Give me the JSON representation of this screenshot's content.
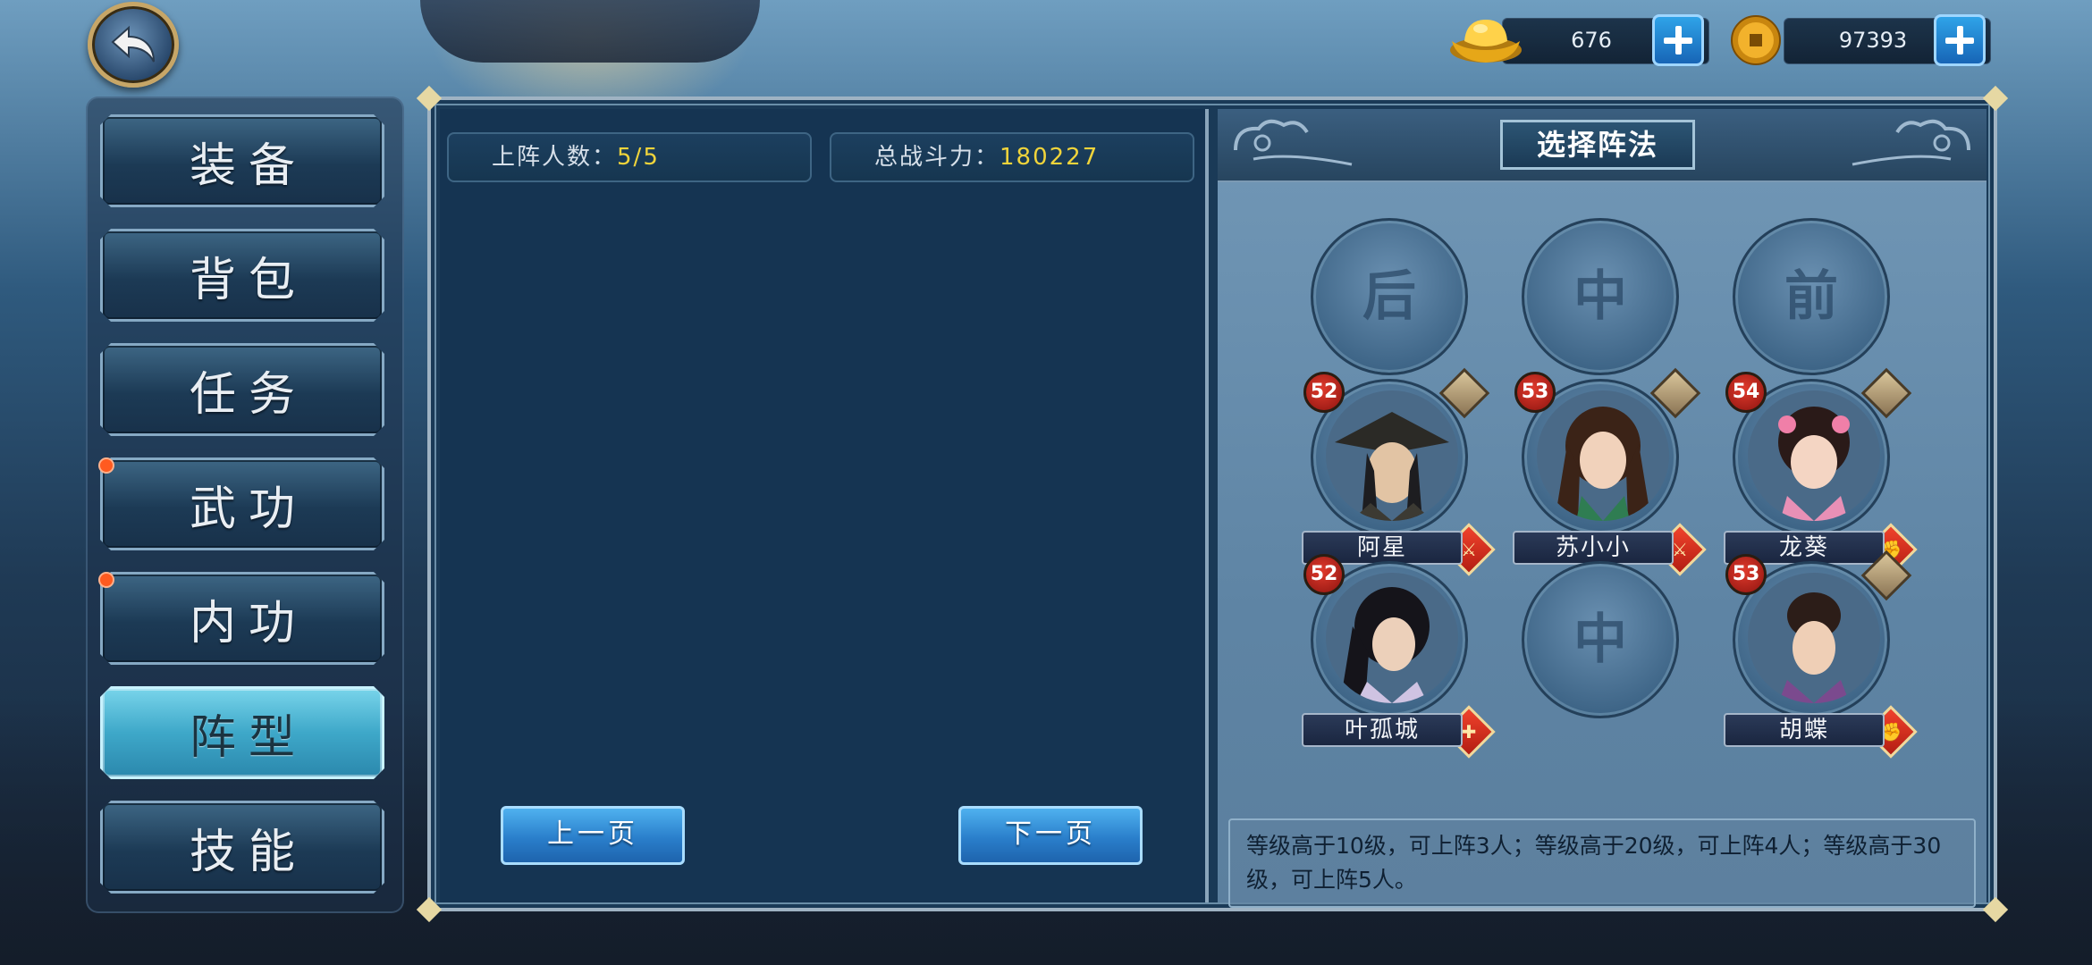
{
  "currency": {
    "gold": {
      "value": "676",
      "icon": "gold-ingot-icon"
    },
    "coin": {
      "value": "97393",
      "icon": "copper-coin-icon"
    }
  },
  "menu": {
    "items": [
      {
        "label": "装备",
        "active": false,
        "dot": false
      },
      {
        "label": "背包",
        "active": false,
        "dot": false
      },
      {
        "label": "任务",
        "active": false,
        "dot": false
      },
      {
        "label": "武功",
        "active": false,
        "dot": true
      },
      {
        "label": "内功",
        "active": false,
        "dot": true
      },
      {
        "label": "阵型",
        "active": true,
        "dot": false
      },
      {
        "label": "技能",
        "active": false,
        "dot": false
      }
    ]
  },
  "stats": {
    "members_label": "上阵人数：",
    "members_value": "5/5",
    "power_label": "总战斗力：",
    "power_value": "180227"
  },
  "pager": {
    "prev": "上一页",
    "next": "下一页"
  },
  "formation": {
    "title": "选择阵法",
    "rows": [
      "后",
      "中",
      "前"
    ],
    "empty_slot_label": "中",
    "heroes": [
      {
        "name": "阿星",
        "level": "52",
        "type": "sword"
      },
      {
        "name": "苏小小",
        "level": "53",
        "type": "sword"
      },
      {
        "name": "龙葵",
        "level": "54",
        "type": "fist"
      },
      {
        "name": "叶孤城",
        "level": "52",
        "type": "swords"
      },
      {
        "name": "胡蝶",
        "level": "53",
        "type": "fist"
      }
    ],
    "tip": "等级高于10级，可上阵3人；等级高于20级，可上阵4人；等级高于30级，可上阵5人。"
  }
}
